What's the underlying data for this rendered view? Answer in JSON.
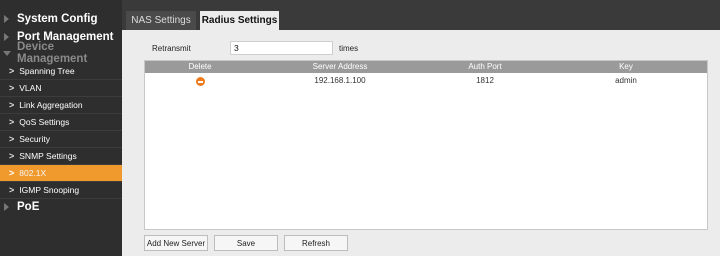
{
  "sidebar": {
    "items": [
      {
        "label": "System Config"
      },
      {
        "label": "Port Management"
      },
      {
        "label": "Device Management"
      },
      {
        "label": "PoE"
      }
    ],
    "sub_items": [
      {
        "label": "Spanning Tree"
      },
      {
        "label": "VLAN"
      },
      {
        "label": "Link Aggregation"
      },
      {
        "label": "QoS Settings"
      },
      {
        "label": "Security"
      },
      {
        "label": "SNMP Settings"
      },
      {
        "label": "802.1X"
      },
      {
        "label": "IGMP Snooping"
      }
    ]
  },
  "tabs": [
    {
      "label": "NAS Settings"
    },
    {
      "label": "Radius Settings"
    }
  ],
  "form": {
    "retransmit_label": "Retransmit",
    "retransmit_value": "3",
    "retransmit_unit": "times"
  },
  "table": {
    "headers": [
      "Delete",
      "Server Address",
      "Auth Port",
      "Key"
    ],
    "rows": [
      {
        "server_address": "192.168.1.100",
        "auth_port": "1812",
        "key": "admin"
      }
    ]
  },
  "buttons": {
    "add_server": "Add New Server",
    "save": "Save",
    "refresh": "Refresh"
  },
  "colors": {
    "accent": "#f09a2e",
    "delete_icon": "#f07a1c"
  }
}
